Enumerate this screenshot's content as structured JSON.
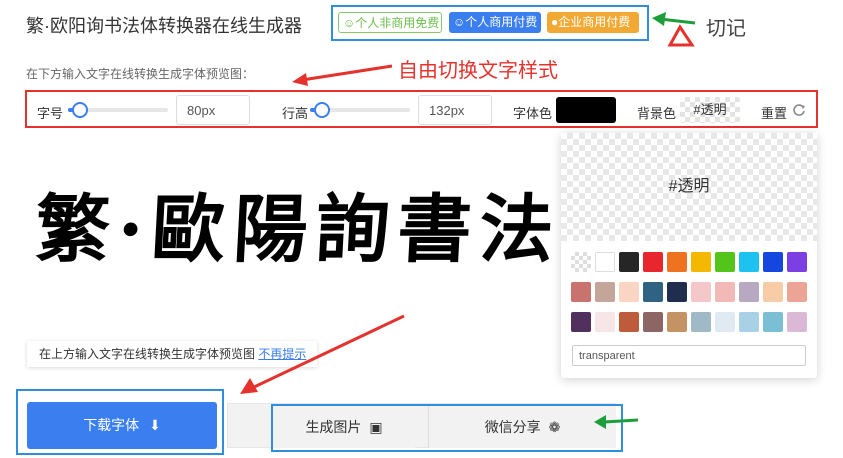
{
  "header": {
    "title": "繁·欧阳询书法体转换器在线生成器",
    "badges": {
      "free": "个人非商用免费",
      "personal": "个人商用付费",
      "enterprise": "企业商用付费"
    }
  },
  "annotations": {
    "remember": "切记",
    "toggle_style": "自由切换文字样式"
  },
  "hint_top": "在下方输入文字在线转换生成字体预览图：",
  "toolbar": {
    "font_size_label": "字号",
    "font_size_value": "80px",
    "font_size_level": 0.1,
    "line_height_label": "行高",
    "line_height_value": "132px",
    "line_height_level": 0.1,
    "font_color_label": "字体色",
    "font_color": "#000000",
    "bg_color_label": "背景色",
    "bg_color_value": "#透明",
    "reset_label": "重置",
    "reset_icon": "refresh-icon"
  },
  "preview": {
    "text": "繁·歐陽詢書法體"
  },
  "color_picker": {
    "current_label": "#透明",
    "hex_value": "transparent",
    "swatches": [
      [
        "transparent",
        "#ffffff",
        "#262626",
        "#e8262d",
        "#ef7220",
        "#f5b800",
        "#52c41a",
        "#1ec2f0",
        "#1546e0",
        "#7c3fe4"
      ],
      [
        "#c9736f",
        "#c4a59a",
        "#fad5c4",
        "#2f6283",
        "#1f2d4e",
        "#f4c7c9",
        "#f2b9b7",
        "#b9a8c1",
        "#f6cda6",
        "#eca595"
      ],
      [
        "#52305e",
        "#f6e6e8",
        "#bd5b3a",
        "#8e6565",
        "#c49363",
        "#9fb9c6",
        "#dfeaf3",
        "#a9d1e5",
        "#7bbfd4",
        "#dbb9d6"
      ]
    ]
  },
  "tip": {
    "text": "在上方输入文字在线转换生成字体预览图",
    "dismiss": "不再提示"
  },
  "actions": {
    "download": "下载字体",
    "generate_image": "生成图片",
    "wechat_share": "微信分享"
  }
}
